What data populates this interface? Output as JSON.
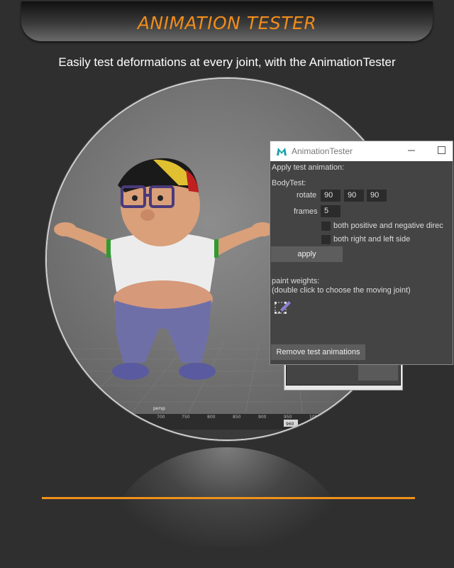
{
  "banner": {
    "title": "ANIMATION TESTER"
  },
  "subtitle": "Easily test deformations at every joint, with the AnimationTester",
  "viewport": {
    "camera_label": "persp",
    "timeline_ticks": [
      "700",
      "750",
      "800",
      "850",
      "900",
      "950",
      "1000"
    ],
    "current_frame": "960"
  },
  "dialog": {
    "title": "AnimationTester",
    "header": "Apply test animation:",
    "section": "BodyTest:",
    "rotate_label": "rotate",
    "rotate_values": [
      "90",
      "90",
      "90"
    ],
    "frames_label": "frames",
    "frames_value": "5",
    "check_posneg": "both positive and negative direc",
    "check_sides": "both right and left side",
    "apply_label": "apply",
    "paint_label": "paint weights:",
    "paint_hint": "(double click to choose the moving joint)",
    "remove_label": "Remove test animations"
  },
  "colors": {
    "accent": "#f0901a",
    "dialog_bg": "#444444",
    "field_bg": "#2b2b2b"
  }
}
